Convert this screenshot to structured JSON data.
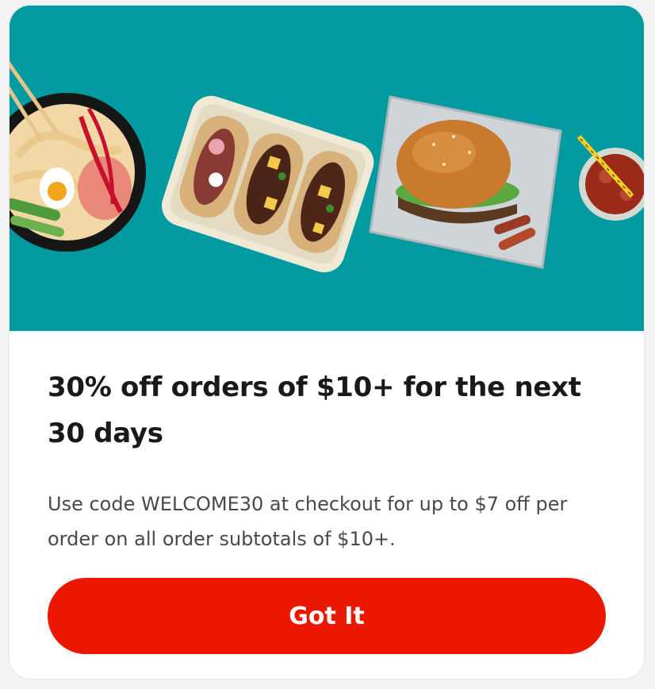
{
  "promo": {
    "title": "30% off orders of $10+ for the next 30 days",
    "description": "Use code WELCOME30 at checkout for up to $7 off per order on all order subtotals of $10+.",
    "button_label": "Got It"
  },
  "hero": {
    "background_color": "#019aa1",
    "images": [
      "ramen-bowl-image",
      "tacos-tray-image",
      "burger-image",
      "iced-drink-image"
    ]
  },
  "colors": {
    "accent": "#eb1700",
    "title_text": "#191919",
    "body_text": "#494949"
  }
}
